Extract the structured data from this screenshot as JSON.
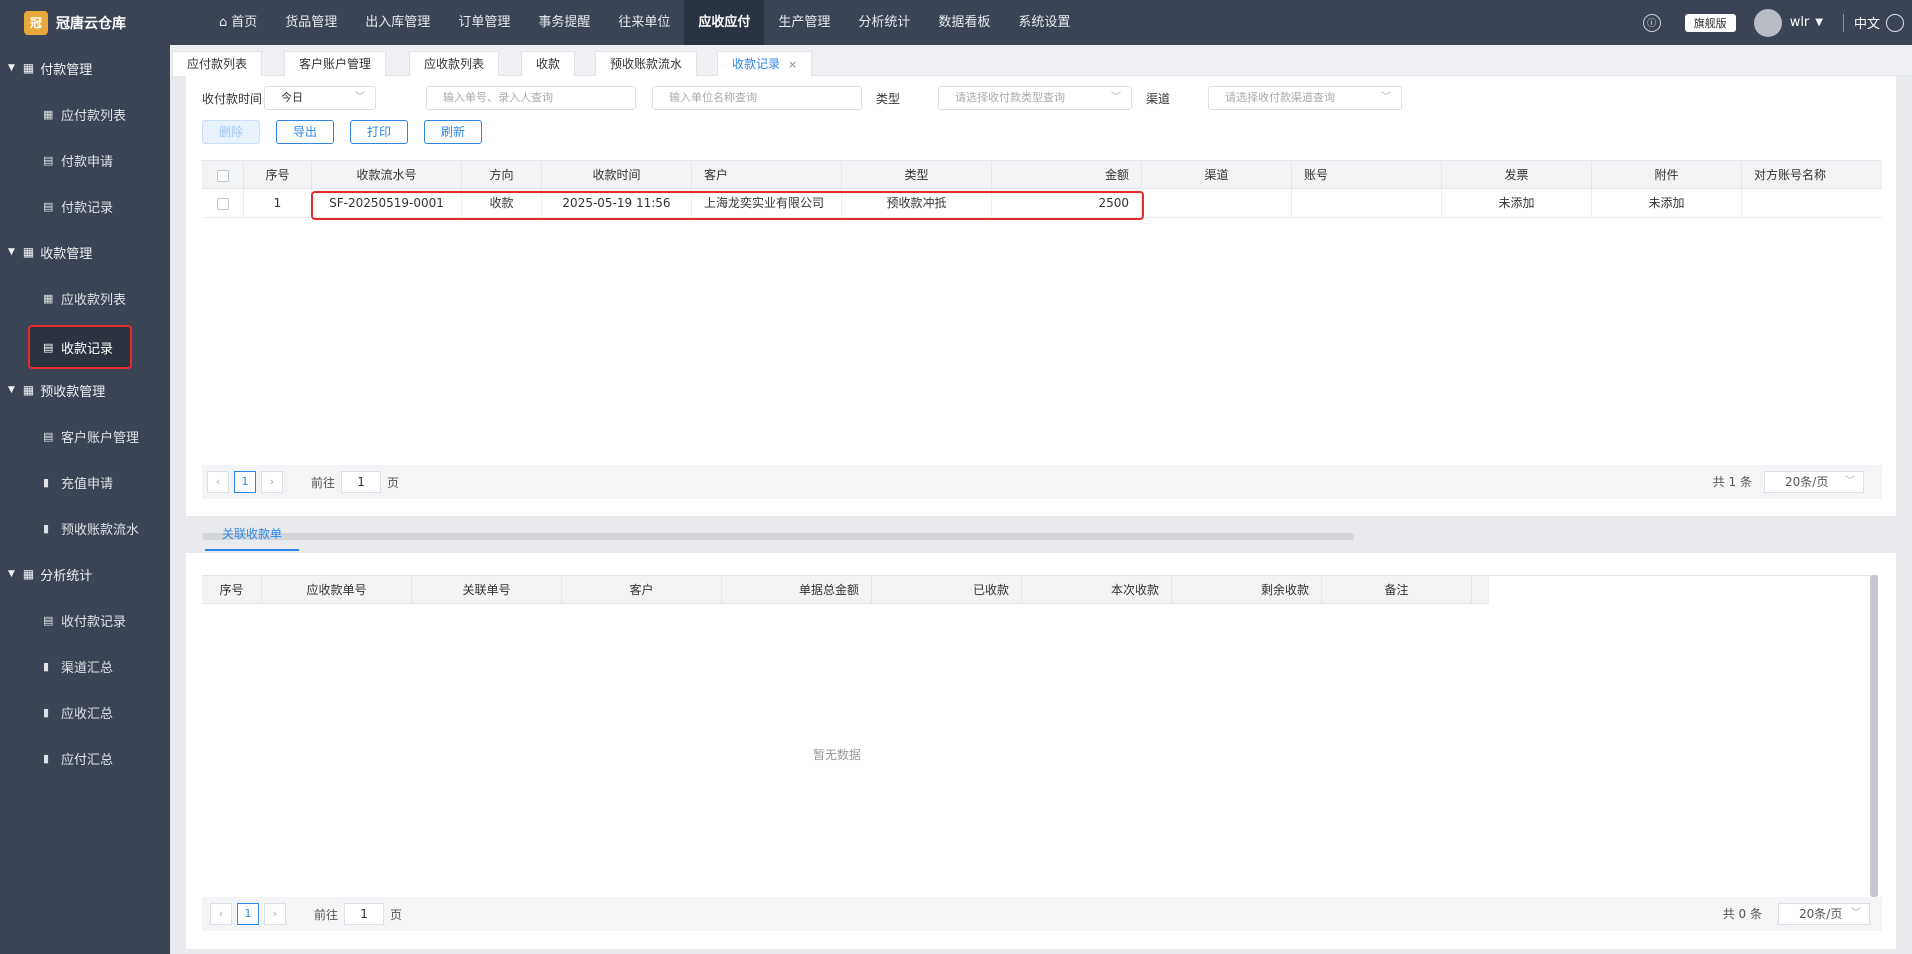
{
  "app": {
    "name": "冠唐云仓库",
    "logo_char": "冠"
  },
  "topnav": {
    "items": [
      {
        "label": "首页"
      },
      {
        "label": "货品管理"
      },
      {
        "label": "出入库管理"
      },
      {
        "label": "订单管理"
      },
      {
        "label": "事务提醒"
      },
      {
        "label": "往来单位"
      },
      {
        "label": "应收应付"
      },
      {
        "label": "生产管理"
      },
      {
        "label": "分析统计"
      },
      {
        "label": "数据看板"
      },
      {
        "label": "系统设置"
      }
    ],
    "active": "应收应付",
    "edition": "旗舰版",
    "user": "wlr",
    "lang": "中文"
  },
  "sidebar": {
    "groups": [
      {
        "label": "付款管理",
        "items": [
          {
            "label": "应付款列表",
            "icon": "grid-icon"
          },
          {
            "label": "付款申请",
            "icon": "doc-icon"
          },
          {
            "label": "付款记录",
            "icon": "doc-icon"
          }
        ]
      },
      {
        "label": "收款管理",
        "items": [
          {
            "label": "应收款列表",
            "icon": "grid-icon"
          },
          {
            "label": "收款记录",
            "icon": "doc-icon"
          }
        ]
      },
      {
        "label": "预收款管理",
        "items": [
          {
            "label": "客户账户管理",
            "icon": "doc-icon"
          },
          {
            "label": "充值申请",
            "icon": "bar-chart-icon"
          },
          {
            "label": "预收账款流水",
            "icon": "bar-chart-icon"
          }
        ]
      },
      {
        "label": "分析统计",
        "items": [
          {
            "label": "收付款记录",
            "icon": "doc-icon"
          },
          {
            "label": "渠道汇总",
            "icon": "bar-chart-icon"
          },
          {
            "label": "应收汇总",
            "icon": "bar-chart-icon"
          },
          {
            "label": "应付汇总",
            "icon": "bar-chart-icon"
          }
        ]
      }
    ],
    "active": "收款记录"
  },
  "tabs": [
    {
      "label": "应付款列表"
    },
    {
      "label": "客户账户管理"
    },
    {
      "label": "应收款列表"
    },
    {
      "label": "收款"
    },
    {
      "label": "预收账款流水"
    },
    {
      "label": "收款记录"
    }
  ],
  "filters": {
    "time_label": "收付款时间",
    "time_value": "今日",
    "order_placeholder": "输入单号、录入人查询",
    "unit_placeholder": "输入单位名称查询",
    "type_label": "类型",
    "type_placeholder": "请选择收付款类型查询",
    "channel_label": "渠道",
    "channel_placeholder": "请选择收付款渠道查询"
  },
  "actions": {
    "delete": "删除",
    "export": "导出",
    "print": "打印",
    "refresh": "刷新"
  },
  "main_table": {
    "columns": [
      "序号",
      "收款流水号",
      "方向",
      "收款时间",
      "客户",
      "类型",
      "金额",
      "渠道",
      "账号",
      "发票",
      "附件",
      "对方账号名称"
    ],
    "rows": [
      [
        "1",
        "SF-20250519-0001",
        "收款",
        "2025-05-19 11:56",
        "上海龙奕实业有限公司",
        "预收款冲抵",
        "2500",
        "",
        "",
        "未添加",
        "未添加",
        ""
      ]
    ]
  },
  "pager1": {
    "goto": "前往",
    "page": "1",
    "page_unit": "页",
    "current": "1",
    "total": "共 1 条",
    "size": "20条/页"
  },
  "subtab": "关联收款单",
  "sub_table": {
    "columns": [
      "序号",
      "应收款单号",
      "关联单号",
      "客户",
      "单据总金额",
      "已收款",
      "本次收款",
      "剩余收款",
      "备注"
    ],
    "empty": "暂无数据"
  },
  "pager2": {
    "goto": "前往",
    "page": "1",
    "page_unit": "页",
    "current": "1",
    "total": "共 0 条",
    "size": "20条/页"
  },
  "colors": {
    "accent": "#2e87e8",
    "sidebar": "#3a4454",
    "highlight": "#e52b2b"
  }
}
